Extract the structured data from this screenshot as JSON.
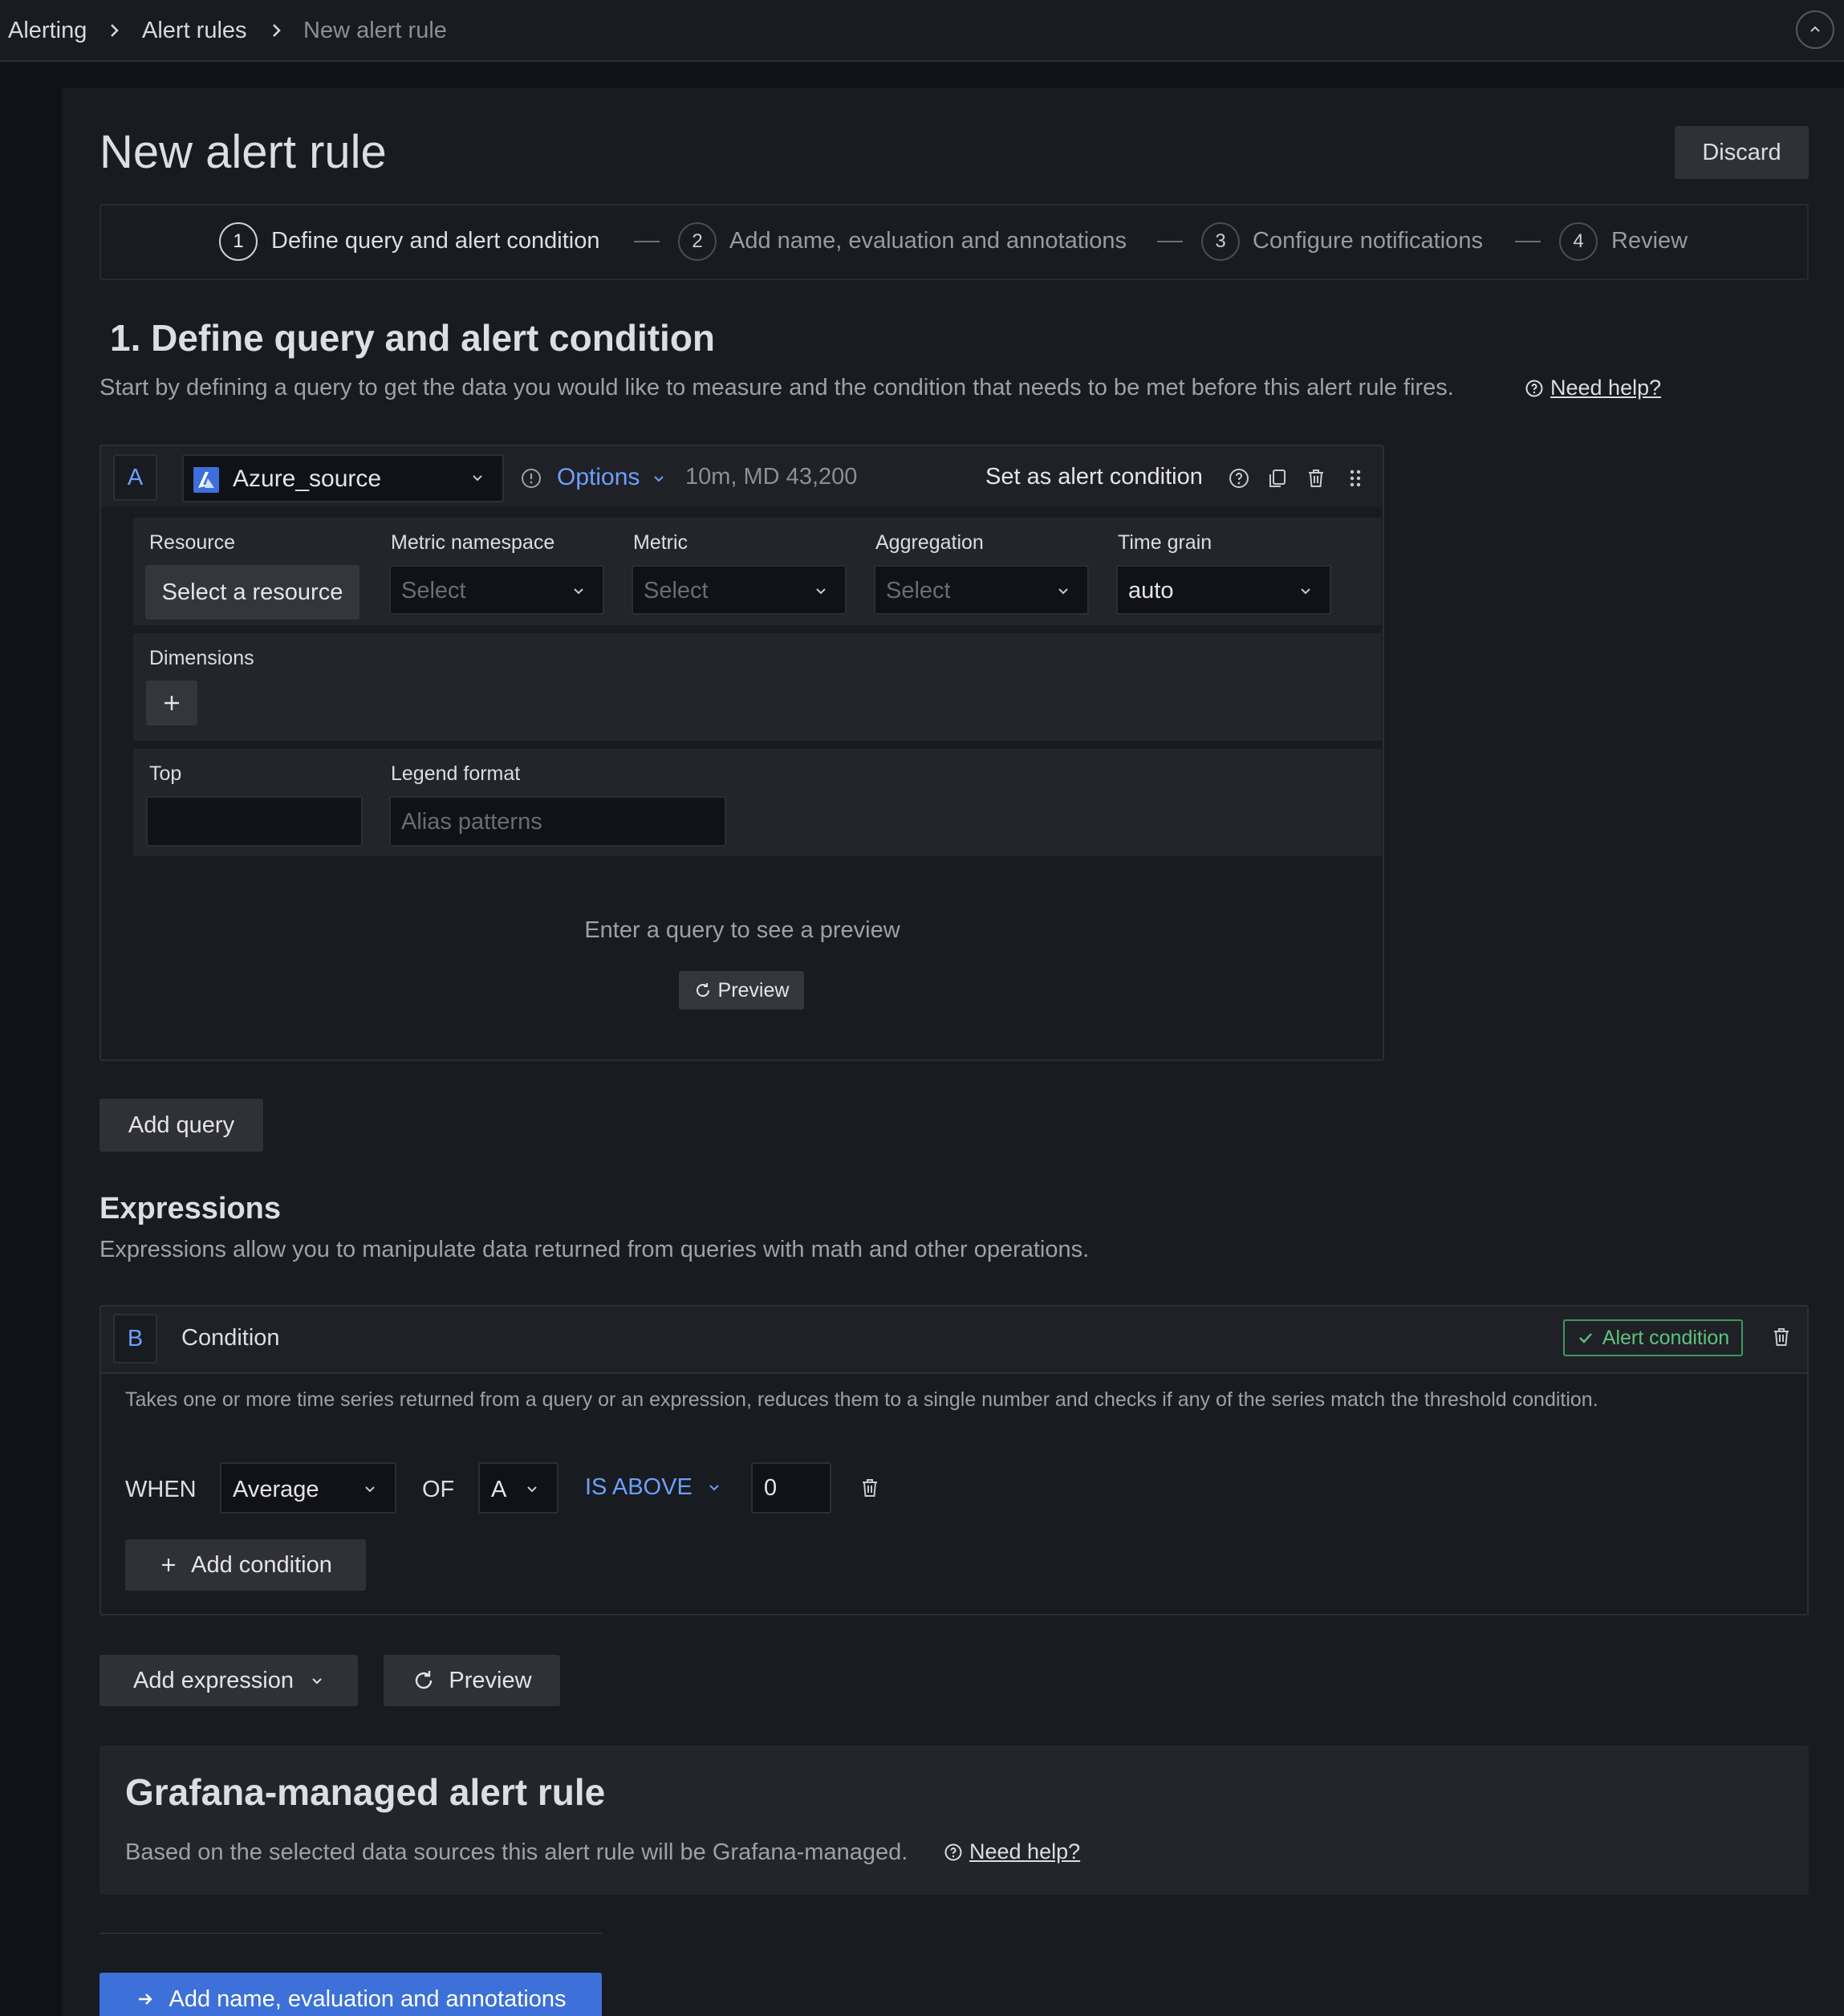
{
  "breadcrumb": {
    "items": [
      "Alerting",
      "Alert rules",
      "New alert rule"
    ]
  },
  "page": {
    "title": "New alert rule",
    "discard_label": "Discard"
  },
  "stepper": {
    "steps": [
      {
        "number": "1",
        "label": "Define query and alert condition"
      },
      {
        "number": "2",
        "label": "Add name, evaluation and annotations"
      },
      {
        "number": "3",
        "label": "Configure notifications"
      },
      {
        "number": "4",
        "label": "Review"
      }
    ],
    "separator": "—"
  },
  "section": {
    "title": "1. Define query and alert condition",
    "description": "Start by defining a query to get the data you would like to measure and the condition that needs to be met before this alert rule fires.",
    "help_label": "Need help?"
  },
  "query": {
    "ref": "A",
    "datasource": "Azure_source",
    "options_label": "Options",
    "options_meta": "10m, MD 43,200",
    "set_condition_label": "Set as alert condition",
    "fields": {
      "resource_label": "Resource",
      "resource_button": "Select a resource",
      "namespace_label": "Metric namespace",
      "namespace_placeholder": "Select",
      "metric_label": "Metric",
      "metric_placeholder": "Select",
      "aggregation_label": "Aggregation",
      "aggregation_placeholder": "Select",
      "timegrain_label": "Time grain",
      "timegrain_value": "auto",
      "dimensions_label": "Dimensions",
      "top_label": "Top",
      "top_value": "",
      "legend_label": "Legend format",
      "legend_placeholder": "Alias patterns"
    },
    "preview_message": "Enter a query to see a preview",
    "preview_button": "Preview"
  },
  "add_query_label": "Add query",
  "expressions": {
    "title": "Expressions",
    "description": "Expressions allow you to manipulate data returned from queries with math and other operations."
  },
  "condition": {
    "ref": "B",
    "title": "Condition",
    "badge": "Alert condition",
    "description": "Takes one or more time series returned from a query or an expression, reduces them to a single number and checks if any of the series match the threshold condition.",
    "when_label": "WHEN",
    "reducer": "Average",
    "of_label": "OF",
    "query_ref": "A",
    "evaluator": "IS ABOVE",
    "threshold": "0",
    "add_condition_label": "Add condition"
  },
  "actions": {
    "add_expression_label": "Add expression",
    "preview_label": "Preview"
  },
  "grafana_managed": {
    "title": "Grafana-managed alert rule",
    "description": "Based on the selected data sources this alert rule will be Grafana-managed.",
    "help_label": "Need help?"
  },
  "next_button": "Add name, evaluation and annotations",
  "colors": {
    "accent": "#3d71d9",
    "link": "#6e9fff",
    "success": "#5ec27e"
  }
}
